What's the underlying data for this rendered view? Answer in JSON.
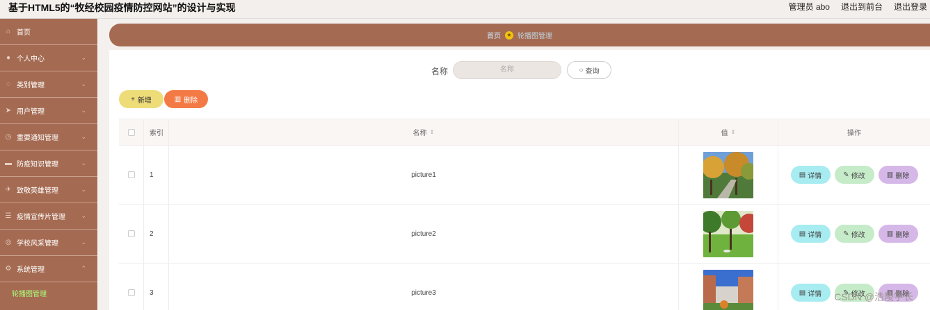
{
  "header": {
    "title": "基于HTML5的“牧经校园疫情防控网站”的设计与实现",
    "user_label": "管理员 abo",
    "to_front": "退出到前台",
    "logout": "退出登录"
  },
  "sidebar": {
    "items": [
      {
        "label": "首页",
        "icon": "home-icon"
      },
      {
        "label": "个人中心",
        "icon": "user-icon"
      },
      {
        "label": "类别管理",
        "icon": "category-icon"
      },
      {
        "label": "用户管理",
        "icon": "send-icon"
      },
      {
        "label": "重要通知管理",
        "icon": "clock-icon"
      },
      {
        "label": "防疫知识管理",
        "icon": "book-icon"
      },
      {
        "label": "致敬英雄管理",
        "icon": "plane-icon"
      },
      {
        "label": "疫情宣传片管理",
        "icon": "list-icon"
      },
      {
        "label": "学校风采管理",
        "icon": "school-icon"
      },
      {
        "label": "系统管理",
        "icon": "gear-icon"
      }
    ],
    "submenu": {
      "label": "轮播图管理"
    }
  },
  "breadcrumb": {
    "home": "首页",
    "current": "轮播图管理"
  },
  "search": {
    "label": "名称",
    "placeholder": "名称",
    "button": "查询"
  },
  "actions": {
    "add": "新增",
    "delete": "删除"
  },
  "table": {
    "headers": {
      "index": "索引",
      "name": "名称",
      "value": "值",
      "ops": "操作"
    },
    "rows": [
      {
        "index": "1",
        "name": "picture1"
      },
      {
        "index": "2",
        "name": "picture2"
      },
      {
        "index": "3",
        "name": "picture3"
      }
    ],
    "op_labels": {
      "detail": "详情",
      "edit": "修改",
      "delete": "删除"
    }
  },
  "watermark": "CSDN @浩陵学长",
  "colors": {
    "sidebar": "#a56b52",
    "add_button": "#eddc78",
    "delete_button": "#f47a45",
    "detail_button": "#a7ecf0",
    "edit_button": "#c6ebc9",
    "op_delete_button": "#d5b8e8",
    "submenu_active": "#a9ff7a"
  }
}
